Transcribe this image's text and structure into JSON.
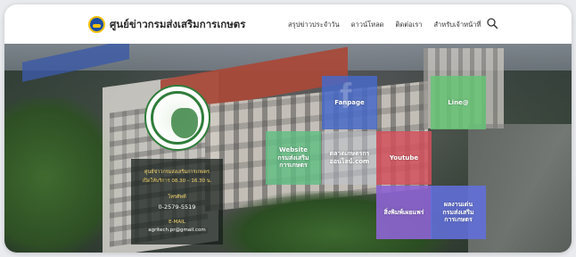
{
  "header": {
    "title": "ศูนย์ข่าวกรมส่งเสริมการเกษตร",
    "nav": [
      "สรุปข่าวประจำวัน",
      "ดาวน์โหลด",
      "ติดต่อเรา",
      "สำหรับเจ้าหน้าที่"
    ],
    "search_icon": "search-icon"
  },
  "info": {
    "line1": "ศูนย์ข่าวกรมส่งเสริมการเกษตร",
    "line2": "เปิดให้บริการ 08.30 – 16.30 น.",
    "phone_label": "โทรศัพท์",
    "phone": "0-2579-5519",
    "email_label": "E-MAIL",
    "email": "agritech.pr@gmail.com"
  },
  "tiles": {
    "fanpage": "Fanpage",
    "line": "Line@",
    "website_line1": "Website",
    "website_line2": "กรมส่งเสริมการเกษตร",
    "online_line1": "ตลาดเกษตรกร",
    "online_line2": "ออนไลน์.com",
    "youtube": "Youtube",
    "apply": "สิ่งพิมพ์เผยแพร่",
    "dept_line1": "ผลงานเด่น",
    "dept_line2": "กรมส่งเสริมการเกษตร"
  },
  "colors": {
    "fanpage": "#4869c8",
    "line": "#66c476",
    "website": "#60be82",
    "youtube": "#d2505c",
    "apply": "#8f64d7",
    "dept": "#6270dc"
  }
}
